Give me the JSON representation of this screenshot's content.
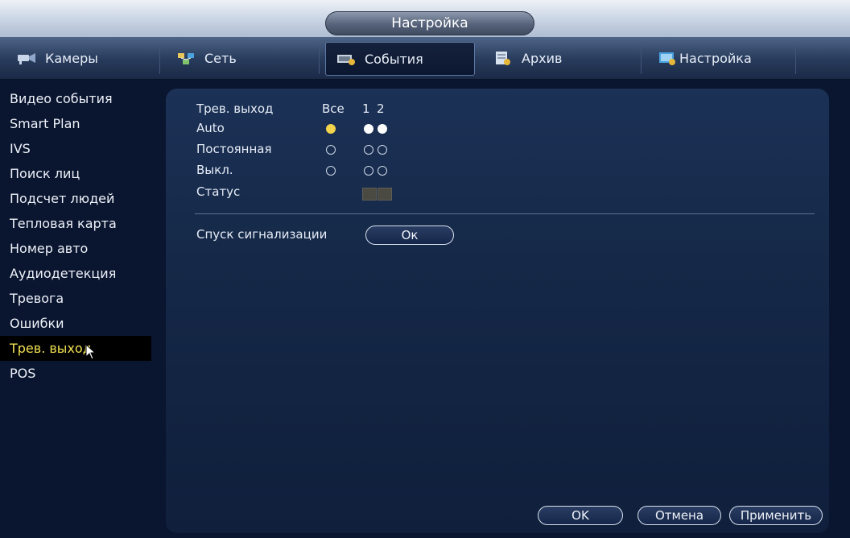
{
  "window": {
    "title": "Настройка"
  },
  "tabs": [
    {
      "label": "Камеры",
      "icon": "camera-icon"
    },
    {
      "label": "Сеть",
      "icon": "network-icon"
    },
    {
      "label": "События",
      "icon": "events-icon",
      "active": true
    },
    {
      "label": "Архив",
      "icon": "archive-icon"
    },
    {
      "label": "Настройка",
      "icon": "system-settings-icon"
    }
  ],
  "sidebar": {
    "items": [
      {
        "label": "Видео события"
      },
      {
        "label": "Smart Plan"
      },
      {
        "label": "IVS"
      },
      {
        "label": "Поиск лиц"
      },
      {
        "label": "Подсчет людей"
      },
      {
        "label": "Тепловая карта"
      },
      {
        "label": "Номер авто"
      },
      {
        "label": "Аудиодетекция"
      },
      {
        "label": "Тревога"
      },
      {
        "label": "Ошибки"
      },
      {
        "label": "Трев. выход",
        "active": true
      },
      {
        "label": "POS"
      }
    ]
  },
  "alarm_out": {
    "header_label": "Трев. выход",
    "col_all": "Все",
    "channels": [
      "1",
      "2"
    ],
    "rows": [
      {
        "label": "Auto",
        "all": "selected",
        "ch": [
          "selected",
          "selected"
        ]
      },
      {
        "label": "Постоянная",
        "all": "unselected",
        "ch": [
          "unselected",
          "unselected"
        ]
      },
      {
        "label": "Выкл.",
        "all": "unselected",
        "ch": [
          "unselected",
          "unselected"
        ]
      }
    ],
    "status_label": "Статус",
    "release_label": "Спуск сигнализации",
    "release_button": "Ок"
  },
  "footer": {
    "ok_button": "OK",
    "cancel_button": "Отмена",
    "apply_button": "Применить"
  },
  "colors": {
    "background": "#0a1530",
    "accent_selected": "#f3d44c",
    "active_sidebar_text": "#f0e050"
  }
}
